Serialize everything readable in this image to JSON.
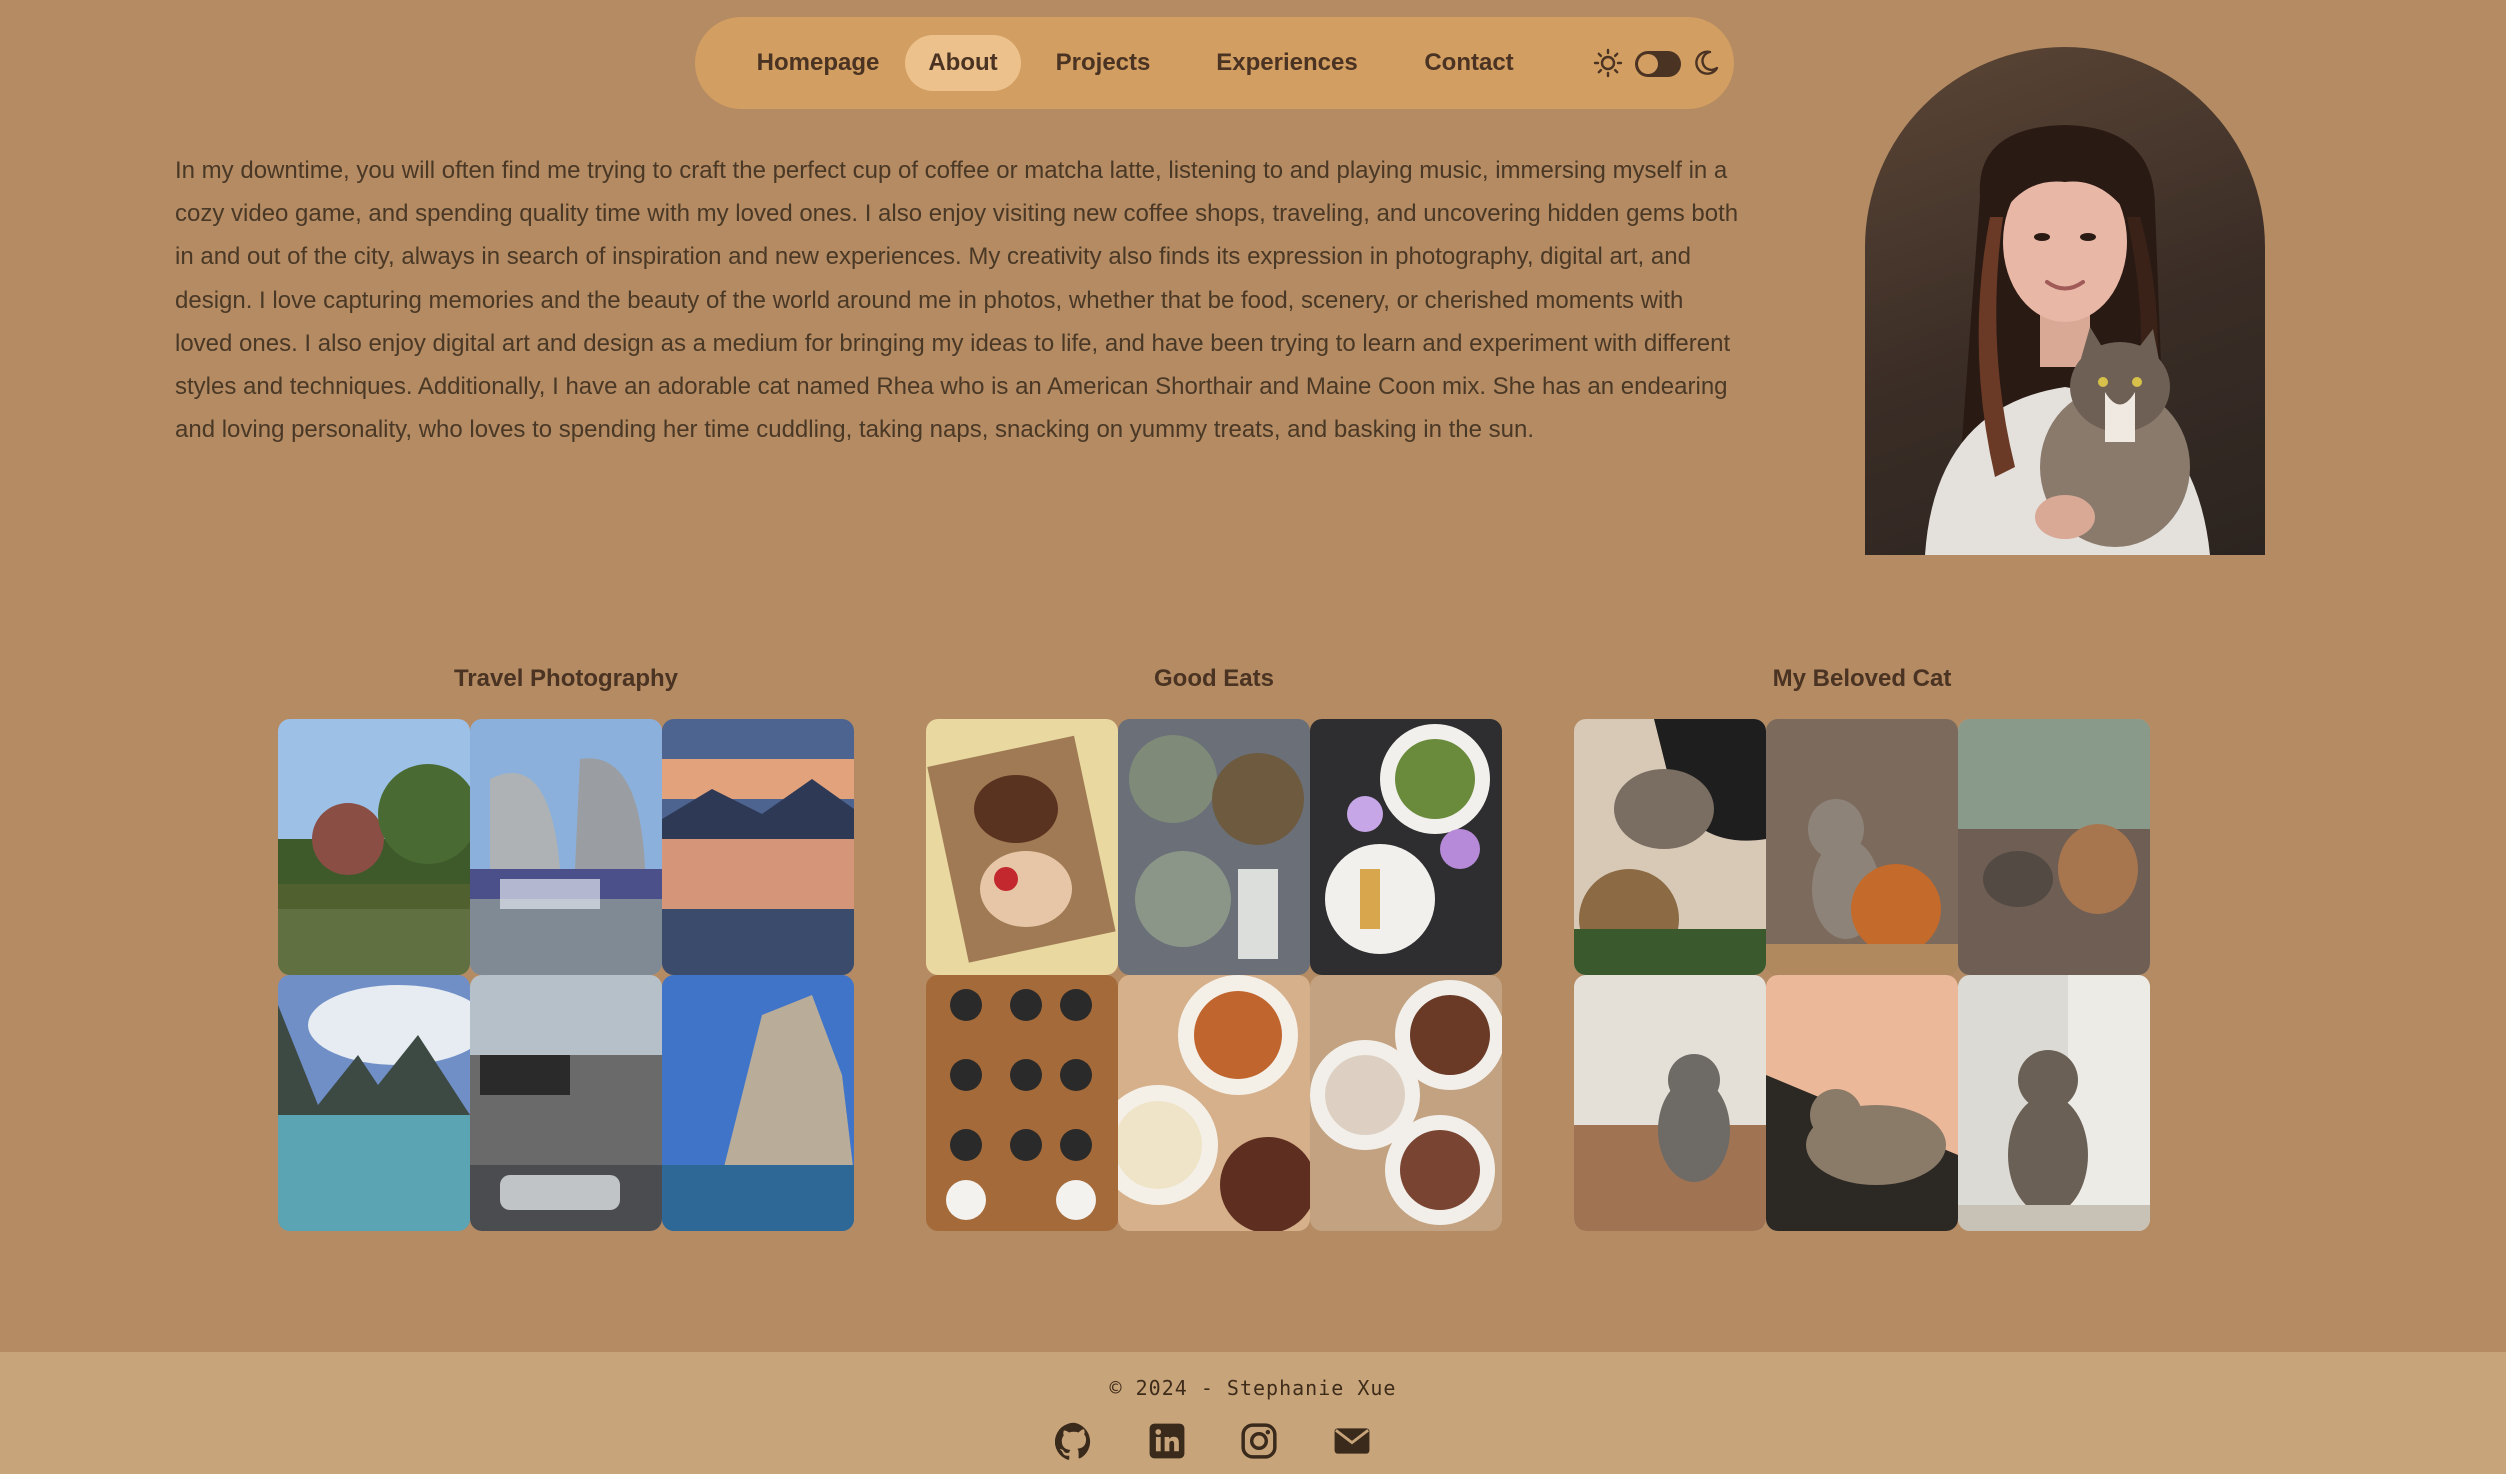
{
  "nav": {
    "items": [
      {
        "label": "Homepage",
        "active": false
      },
      {
        "label": "About",
        "active": true
      },
      {
        "label": "Projects",
        "active": false
      },
      {
        "label": "Experiences",
        "active": false
      },
      {
        "label": "Contact",
        "active": false
      }
    ],
    "theme_toggle": {
      "light_icon": "sun-icon",
      "dark_icon": "moon-icon",
      "mode": "light"
    }
  },
  "about": {
    "text": "In my downtime, you will often find me trying to craft the perfect cup of coffee or matcha latte, listening to and playing music, immersing myself in a cozy video game, and spending quality time with my loved ones. I also enjoy visiting new coffee shops, traveling, and uncovering hidden gems both in and out of the city, always in search of inspiration and new experiences. My creativity also finds its expression in photography, digital art, and design. I love capturing memories and the beauty of the world around me in photos, whether that be food, scenery, or cherished moments with loved ones. I also enjoy digital art and design as a medium for bringing my ideas to life, and have been trying to learn and experiment with different styles and techniques. Additionally, I have an adorable cat named Rhea who is an American Shorthair and Maine Coon mix. She has an endearing and loving personality, who loves to spending her time cuddling, taking naps, snacking on yummy treats, and basking in the sun."
  },
  "galleries": [
    {
      "title": "Travel Photography"
    },
    {
      "title": "Good Eats"
    },
    {
      "title": "My Beloved Cat"
    }
  ],
  "footer": {
    "copyright": "© 2024 - Stephanie Xue",
    "social": [
      {
        "icon": "github-icon"
      },
      {
        "icon": "linkedin-icon"
      },
      {
        "icon": "instagram-icon"
      },
      {
        "icon": "email-icon"
      }
    ]
  },
  "colors": {
    "background": "#b48b62",
    "nav_bg": "#d29e62",
    "nav_active": "#ecc18b",
    "footer_bg": "#c8a47a",
    "text": "#4a3826"
  }
}
